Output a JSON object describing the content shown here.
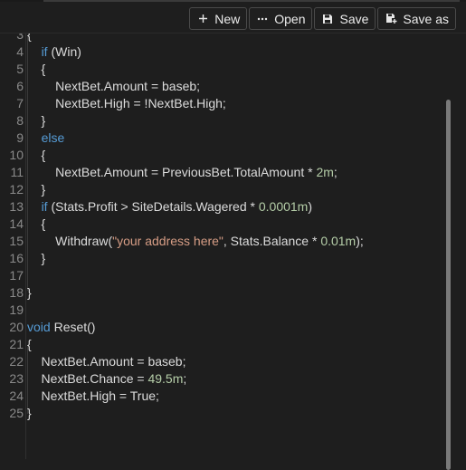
{
  "toolbar": {
    "new_label": "New",
    "open_label": "Open",
    "save_label": "Save",
    "save_as_label": "Save as",
    "new_icon": "plus-icon",
    "open_icon": "ellipsis-icon",
    "save_icon": "floppy-disk-icon",
    "save_as_icon": "save-as-icon"
  },
  "colors": {
    "background": "#1e1e1e",
    "text": "#dcdcdc",
    "keyword": "#569cd6",
    "string": "#d69d85",
    "number": "#b5cea8",
    "line_number": "#8a8a8a"
  },
  "editor": {
    "lines": [
      {
        "num": "3",
        "tokens": [
          {
            "t": "{",
            "c": ""
          }
        ]
      },
      {
        "num": "4",
        "tokens": [
          {
            "t": "    ",
            "c": ""
          },
          {
            "t": "if",
            "c": "kw"
          },
          {
            "t": " (Win)",
            "c": ""
          }
        ]
      },
      {
        "num": "5",
        "tokens": [
          {
            "t": "    {",
            "c": ""
          }
        ]
      },
      {
        "num": "6",
        "tokens": [
          {
            "t": "        NextBet.Amount = baseb;",
            "c": ""
          }
        ]
      },
      {
        "num": "7",
        "tokens": [
          {
            "t": "        NextBet.High = !NextBet.High;",
            "c": ""
          }
        ]
      },
      {
        "num": "8",
        "tokens": [
          {
            "t": "    }",
            "c": ""
          }
        ]
      },
      {
        "num": "9",
        "tokens": [
          {
            "t": "    ",
            "c": ""
          },
          {
            "t": "else",
            "c": "kw"
          }
        ]
      },
      {
        "num": "10",
        "tokens": [
          {
            "t": "    {",
            "c": ""
          }
        ]
      },
      {
        "num": "11",
        "tokens": [
          {
            "t": "        NextBet.Amount = PreviousBet.TotalAmount * ",
            "c": ""
          },
          {
            "t": "2m",
            "c": "num"
          },
          {
            "t": ";",
            "c": ""
          }
        ]
      },
      {
        "num": "12",
        "tokens": [
          {
            "t": "    }",
            "c": ""
          }
        ]
      },
      {
        "num": "13",
        "tokens": [
          {
            "t": "    ",
            "c": ""
          },
          {
            "t": "if",
            "c": "kw"
          },
          {
            "t": " (Stats.Profit > SiteDetails.Wagered * ",
            "c": ""
          },
          {
            "t": "0.0001m",
            "c": "num"
          },
          {
            "t": ")",
            "c": ""
          }
        ]
      },
      {
        "num": "14",
        "tokens": [
          {
            "t": "    {",
            "c": ""
          }
        ]
      },
      {
        "num": "15",
        "tokens": [
          {
            "t": "        Withdraw(",
            "c": ""
          },
          {
            "t": "\"your address here\"",
            "c": "str"
          },
          {
            "t": ", Stats.Balance * ",
            "c": ""
          },
          {
            "t": "0.01m",
            "c": "num"
          },
          {
            "t": ");",
            "c": ""
          }
        ]
      },
      {
        "num": "16",
        "tokens": [
          {
            "t": "    }",
            "c": ""
          }
        ]
      },
      {
        "num": "17",
        "tokens": []
      },
      {
        "num": "18",
        "tokens": [
          {
            "t": "}",
            "c": ""
          }
        ]
      },
      {
        "num": "19",
        "tokens": []
      },
      {
        "num": "20",
        "tokens": [
          {
            "t": "void",
            "c": "kw"
          },
          {
            "t": " Reset()",
            "c": ""
          }
        ]
      },
      {
        "num": "21",
        "tokens": [
          {
            "t": "{",
            "c": ""
          }
        ]
      },
      {
        "num": "22",
        "tokens": [
          {
            "t": "    NextBet.Amount = baseb;",
            "c": ""
          }
        ]
      },
      {
        "num": "23",
        "tokens": [
          {
            "t": "    NextBet.Chance = ",
            "c": ""
          },
          {
            "t": "49.5m",
            "c": "num"
          },
          {
            "t": ";",
            "c": ""
          }
        ]
      },
      {
        "num": "24",
        "tokens": [
          {
            "t": "    NextBet.High = True;",
            "c": ""
          }
        ]
      },
      {
        "num": "25",
        "tokens": [
          {
            "t": "}",
            "c": ""
          }
        ]
      }
    ]
  }
}
